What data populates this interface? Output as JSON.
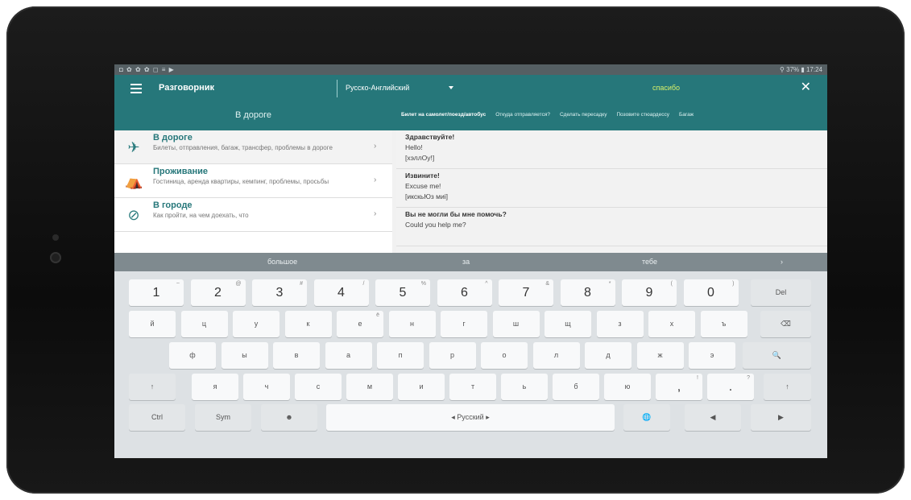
{
  "status_bar": {
    "left": "◘ ✿ ✿ ✿ ◻ ≡ ▶",
    "right": "⚲ 37% ▮ 17:24"
  },
  "app_bar": {
    "title": "Разговорник",
    "language": "Русско-Английский",
    "search": "спасибо"
  },
  "section_title": "В дороге",
  "tabs": [
    "Билет на самолет/поезд/автобус",
    "Откуда отправляется?",
    "Сделать пересадку",
    "Позовите стюардессу",
    "Багаж"
  ],
  "categories": [
    {
      "title": "В дороге",
      "subtitle": "Билеты, отправления, багаж, трансфер, проблемы в дороге"
    },
    {
      "title": "Проживание",
      "subtitle": "Гостиница, аренда квартиры, кемпинг, проблемы, просьбы"
    },
    {
      "title": "В городе",
      "subtitle": "Как пройти, на чем доехать, что"
    }
  ],
  "phrases": [
    {
      "ru": "Здравствуйте!",
      "en": "Hello!",
      "tr": "[хэллОу!]"
    },
    {
      "ru": "Извините!",
      "en": "Excuse me!",
      "tr": "[икскьЮз миi]"
    },
    {
      "ru": "Вы не могли бы мне помочь?",
      "en": "Could you help me?",
      "tr": ""
    }
  ],
  "suggestions": [
    "большое",
    "за",
    "тебе",
    "›"
  ],
  "keyboard": {
    "numbers": [
      {
        "k": "1",
        "a": "~"
      },
      {
        "k": "2",
        "a": "@"
      },
      {
        "k": "3",
        "a": "#"
      },
      {
        "k": "4",
        "a": "/"
      },
      {
        "k": "5",
        "a": "%"
      },
      {
        "k": "6",
        "a": "^"
      },
      {
        "k": "7",
        "a": "&"
      },
      {
        "k": "8",
        "a": "*"
      },
      {
        "k": "9",
        "a": "("
      },
      {
        "k": "0",
        "a": ")"
      }
    ],
    "del": "Del",
    "row1": [
      "й",
      "ц",
      "у",
      "к",
      "е",
      "н",
      "г",
      "ш",
      "щ",
      "з",
      "х",
      "ъ"
    ],
    "row1_hint": "ё",
    "row2": [
      "ф",
      "ы",
      "в",
      "а",
      "п",
      "р",
      "о",
      "л",
      "д",
      "ж",
      "э"
    ],
    "row3": [
      "я",
      "ч",
      "с",
      "м",
      "и",
      "т",
      "ь",
      "б",
      "ю"
    ],
    "punct": [
      {
        "k": ",",
        "a": "!"
      },
      {
        "k": ".",
        "a": "?"
      }
    ],
    "ctrl": "Ctrl",
    "sym": "Sym",
    "space": "◂   Русский   ▸",
    "search_key": "🔍",
    "backspace": "⌫",
    "shift": "↑",
    "left": "◀",
    "right": "▶",
    "globe": "🌐",
    "emoji": "☻"
  },
  "colors": {
    "brand": "#26777a",
    "highlight": "#d6f06a"
  }
}
